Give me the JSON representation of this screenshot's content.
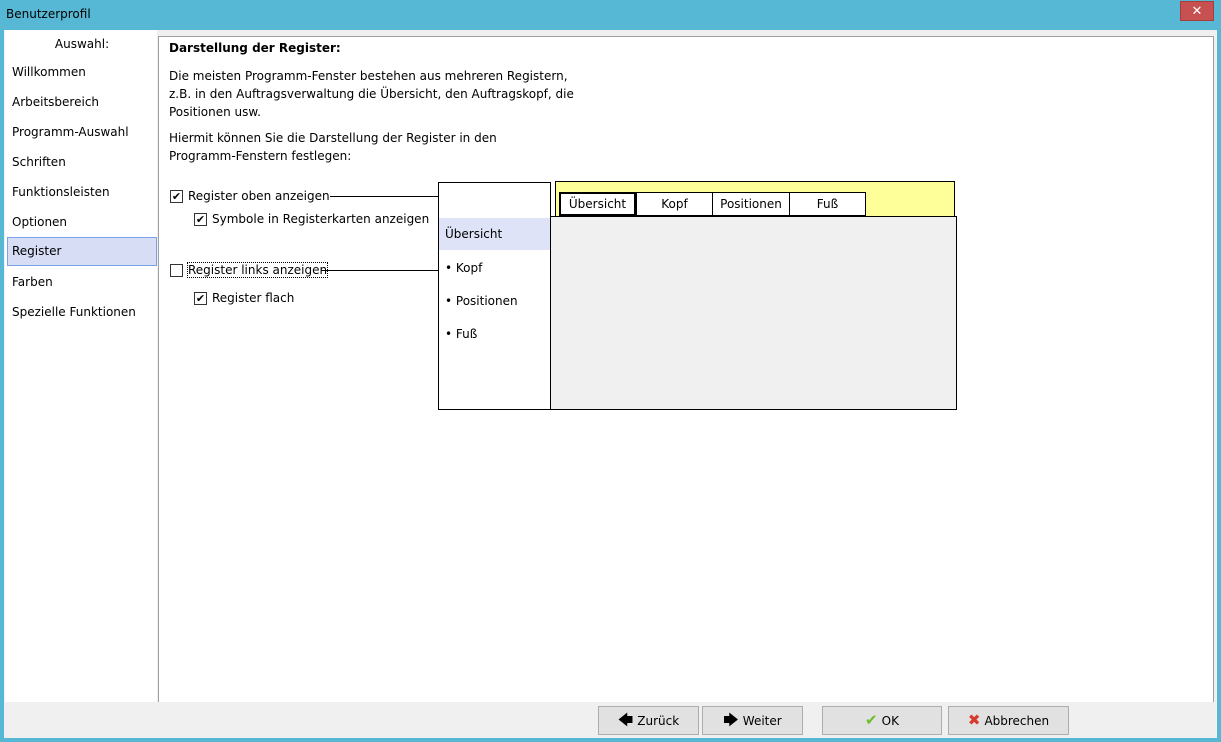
{
  "window": {
    "title": "Benutzerprofil",
    "close_glyph": "✕"
  },
  "sidebar": {
    "header": "Auswahl:",
    "items": [
      {
        "label": "Willkommen"
      },
      {
        "label": "Arbeitsbereich"
      },
      {
        "label": "Programm-Auswahl"
      },
      {
        "label": "Schriften"
      },
      {
        "label": "Funktionsleisten"
      },
      {
        "label": "Optionen"
      },
      {
        "label": "Register",
        "selected": true
      },
      {
        "label": "Farben"
      },
      {
        "label": "Spezielle Funktionen"
      }
    ]
  },
  "content": {
    "heading": "Darstellung der Register:",
    "para1": "Die meisten Programm-Fenster bestehen aus mehreren Registern,\nz.B. in den Auftragsverwaltung die Übersicht, den Auftragskopf, die\nPositionen usw.",
    "para2": "Hiermit können Sie die Darstellung der Register in den\nProgramm-Fenstern festlegen:",
    "options": {
      "top_tabs": {
        "label": "Register oben anzeigen",
        "checked": true
      },
      "tab_symbols": {
        "label": "Symbole in Registerkarten anzeigen",
        "checked": true
      },
      "left_tabs": {
        "label": "Register links anzeigen",
        "checked": false
      },
      "flat_tabs": {
        "label": "Register flach",
        "checked": true
      }
    },
    "check_glyph": "✔",
    "preview": {
      "left_items": [
        "Übersicht",
        "• Kopf",
        "• Positionen",
        "• Fuß"
      ],
      "top_tabs": [
        "Übersicht",
        "Kopf",
        "Positionen",
        "Fuß"
      ],
      "top_bg_color": "#ffff99",
      "left_selected_color": "#dfe3f7"
    }
  },
  "buttons": {
    "back": {
      "label": "Zurück",
      "icon": "arrow-left-icon",
      "glyph": "🡄"
    },
    "next": {
      "label": "Weiter",
      "icon": "arrow-right-icon",
      "glyph": "🡆"
    },
    "ok": {
      "label": "OK",
      "icon": "check-icon",
      "glyph": "✔"
    },
    "cancel": {
      "label": "Abbrechen",
      "icon": "cross-icon",
      "glyph": "✖"
    }
  }
}
